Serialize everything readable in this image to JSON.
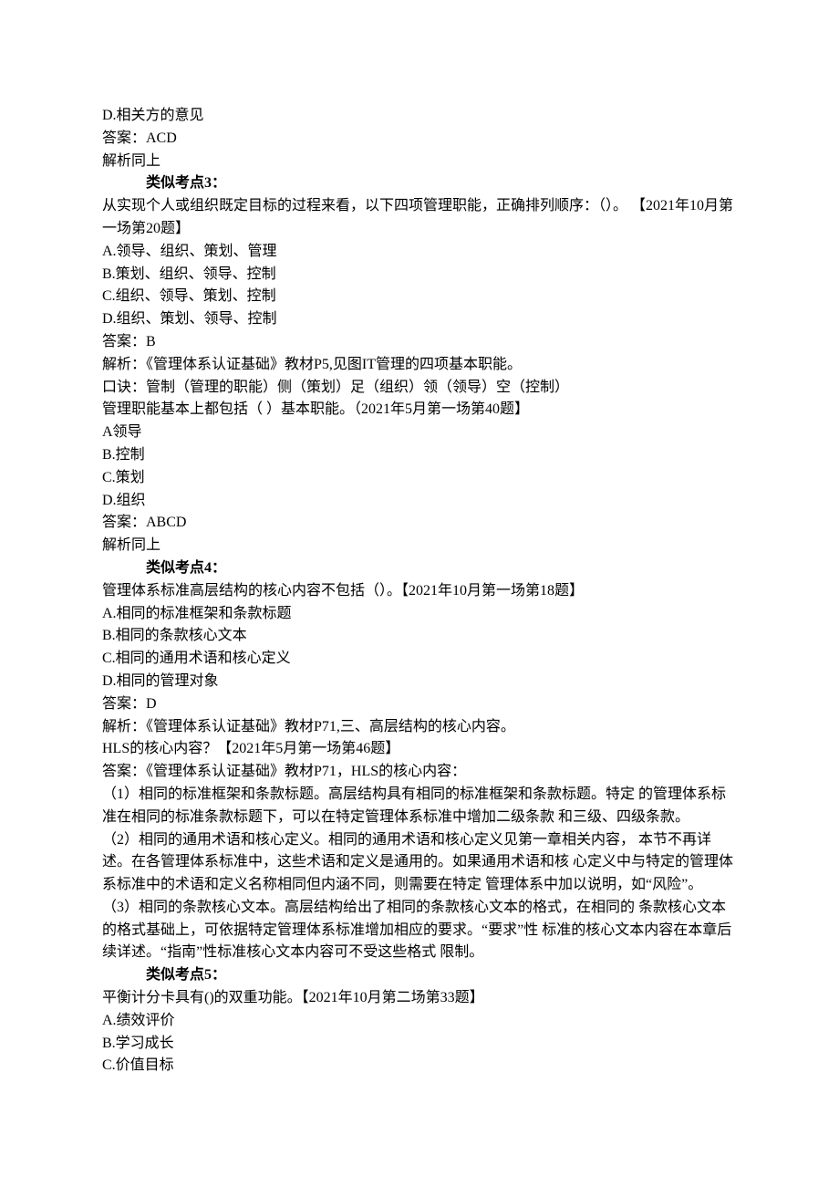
{
  "q0": {
    "optD": "D.相关方的意见",
    "answer": "答案：ACD",
    "explain": "解析同上"
  },
  "sec3": {
    "title": "类似考点3：",
    "q1": {
      "stem": "从实现个人或组织既定目标的过程来看，以下四项管理职能，正确排列顺序：（）。 【2021年10月第一场第20题】",
      "A": "A.领导、组织、策划、管理",
      "B": "B.策划、组织、领导、控制",
      "C": "C.组织、领导、策划、控制",
      "D": "D.组织、策划、领导、控制",
      "answer": "答案：B",
      "explain": "解析：《管理体系认证基础》教材P5,见图IT管理的四项基本职能。",
      "mnemonic": "口诀：管制（管理的职能）侧（策划）足（组织）领（领导）空（控制）"
    },
    "q2": {
      "stem": "管理职能基本上都包括（        ）基本职能。（2021年5月第一场第40题】",
      "A": "A领导",
      "B": "B.控制",
      "C": "C.策划",
      "D": "D.组织",
      "answer": "答案：ABCD",
      "explain": "解析同上"
    }
  },
  "sec4": {
    "title": "类似考点4：",
    "q1": {
      "stem": "管理体系标准高层结构的核心内容不包括（）。【2021年10月第一场第18题】",
      "A": "A.相同的标准框架和条款标题",
      "B": "B.相同的条款核心文本",
      "C": "C.相同的通用术语和核心定义",
      "D": "D.相同的管理对象",
      "answer": "答案：D",
      "explain": "解析：《管理体系认证基础》教材P71,三、高层结构的核心内容。"
    },
    "q2": {
      "stem": "HLS的核心内容？【2021年5月第一场第46题】",
      "answer": "答案：《管理体系认证基础》教材P71，HLS的核心内容：",
      "p1": "（1）相同的标准框架和条款标题。高层结构具有相同的标准框架和条款标题。特定 的管理体系标准在相同的标准条款标题下，可以在特定管理体系标准中增加二级条款 和三级、四级条款。",
      "p2": "（2）相同的通用术语和核心定义。相同的通用术语和核心定义见第一章相关内容， 本节不再详述。在各管理体系标准中，这些术语和定义是通用的。如果通用术语和核 心定义中与特定的管理体系标准中的术语和定义名称相同但内涵不同，则需要在特定 管理体系中加以说明，如“风险”。",
      "p3": "（3）相同的条款核心文本。高层结构给出了相同的条款核心文本的格式，在相同的 条款核心文本的格式基础上，可依据特定管理体系标准增加相应的要求。“要求”性 标准的核心文本内容在本章后续详述。“指南”性标准核心文本内容可不受这些格式 限制。"
    }
  },
  "sec5": {
    "title": "类似考点5：",
    "q1": {
      "stem": "平衡计分卡具有()的双重功能。【2021年10月第二场第33题】",
      "A": "A.绩效评价",
      "B": "B.学习成长",
      "C": "C.价值目标"
    }
  }
}
